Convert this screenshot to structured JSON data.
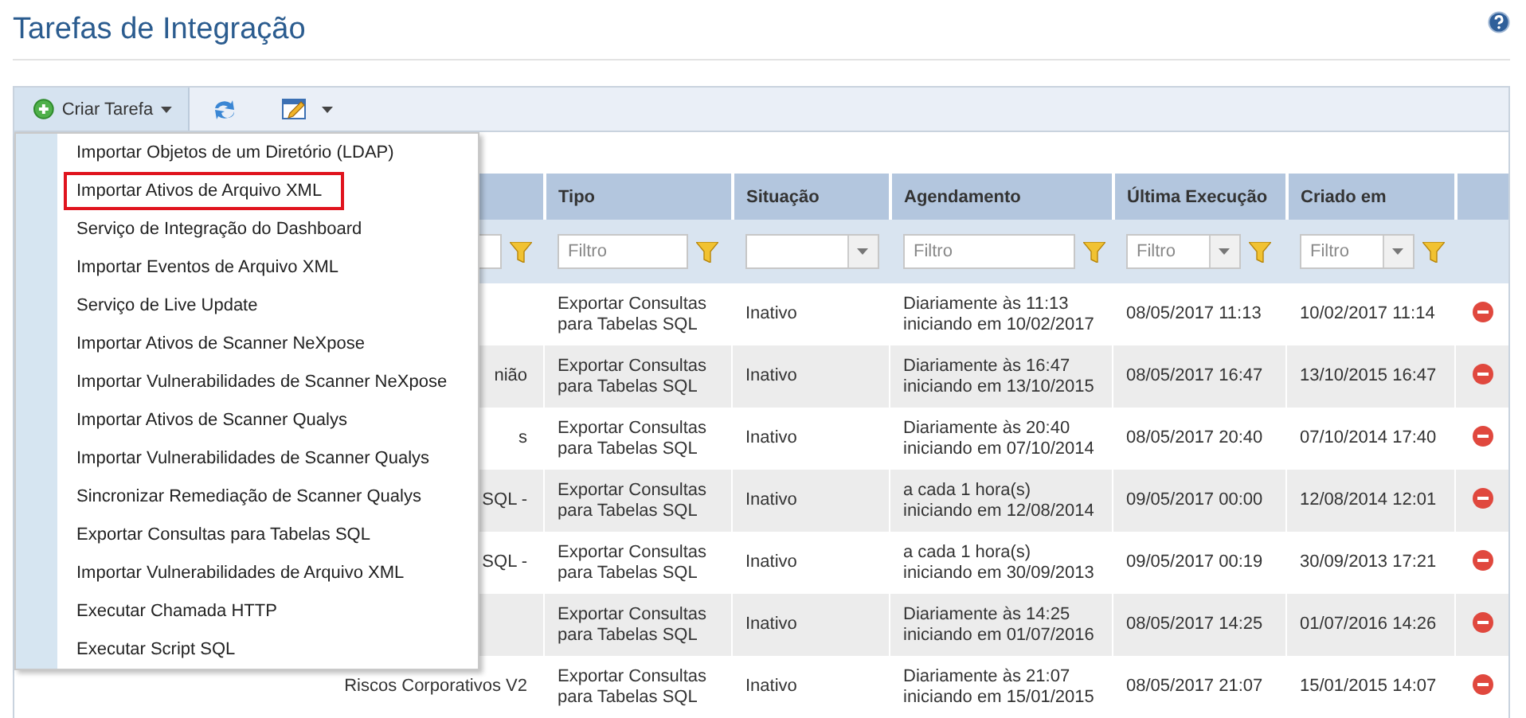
{
  "page": {
    "title": "Tarefas de Integração"
  },
  "toolbar": {
    "create_button": {
      "label": "Criar Tarefa",
      "open": true
    }
  },
  "create_menu": [
    {
      "label": "Importar Objetos de um Diretório (LDAP)",
      "highlighted": false
    },
    {
      "label": "Importar Ativos de Arquivo XML",
      "highlighted": true
    },
    {
      "label": "Serviço de Integração do Dashboard",
      "highlighted": false
    },
    {
      "label": "Importar Eventos de Arquivo XML",
      "highlighted": false
    },
    {
      "label": "Serviço de Live Update",
      "highlighted": false
    },
    {
      "label": "Importar Ativos de Scanner NeXpose",
      "highlighted": false
    },
    {
      "label": "Importar Vulnerabilidades de Scanner NeXpose",
      "highlighted": false
    },
    {
      "label": "Importar Ativos de Scanner Qualys",
      "highlighted": false
    },
    {
      "label": "Importar Vulnerabilidades de Scanner Qualys",
      "highlighted": false
    },
    {
      "label": "Sincronizar Remediação de Scanner Qualys",
      "highlighted": false
    },
    {
      "label": "Exportar Consultas para Tabelas SQL",
      "highlighted": false
    },
    {
      "label": "Importar Vulnerabilidades de Arquivo XML",
      "highlighted": false
    },
    {
      "label": "Executar Chamada HTTP",
      "highlighted": false
    },
    {
      "label": "Executar Script SQL",
      "highlighted": false
    }
  ],
  "table": {
    "columns": [
      "Tipo",
      "Situação",
      "Agendamento",
      "Última Execução",
      "Criado em"
    ],
    "filters": [
      {
        "kind": "text",
        "funnel": true
      },
      {
        "kind": "text",
        "placeholder": "Filtro",
        "funnel": true
      },
      {
        "kind": "select",
        "funnel": false
      },
      {
        "kind": "text",
        "placeholder": "Filtro",
        "funnel": true
      },
      {
        "kind": "select",
        "placeholder": "Filtro",
        "funnel": true
      },
      {
        "kind": "select",
        "placeholder": "Filtro",
        "funnel": true
      }
    ],
    "rows": [
      {
        "type": [
          "Exportar Consultas",
          "para Tabelas SQL"
        ],
        "status": "Inativo",
        "schedule": [
          "Diariamente às 11:13",
          "iniciando em 10/02/2017"
        ],
        "last_run": "08/05/2017 11:13",
        "created": "10/02/2017 11:14"
      },
      {
        "name": "nião",
        "type": [
          "Exportar Consultas",
          "para Tabelas SQL"
        ],
        "status": "Inativo",
        "schedule": [
          "Diariamente às 16:47",
          "iniciando em 13/10/2015"
        ],
        "last_run": "08/05/2017 16:47",
        "created": "13/10/2015 16:47"
      },
      {
        "name": "s",
        "type": [
          "Exportar Consultas",
          "para Tabelas SQL"
        ],
        "status": "Inativo",
        "schedule": [
          "Diariamente às 20:40",
          "iniciando em 07/10/2014"
        ],
        "last_run": "08/05/2017 20:40",
        "created": "07/10/2014 17:40"
      },
      {
        "name": "SQL -",
        "type": [
          "Exportar Consultas",
          "para Tabelas SQL"
        ],
        "status": "Inativo",
        "schedule": [
          "a cada 1 hora(s)",
          "iniciando em 12/08/2014"
        ],
        "last_run": "09/05/2017 00:00",
        "created": "12/08/2014 12:01"
      },
      {
        "name": "SQL -",
        "type": [
          "Exportar Consultas",
          "para Tabelas SQL"
        ],
        "status": "Inativo",
        "schedule": [
          "a cada 1 hora(s)",
          "iniciando em 30/09/2013"
        ],
        "last_run": "09/05/2017 00:19",
        "created": "30/09/2013 17:21"
      },
      {
        "type": [
          "Exportar Consultas",
          "para Tabelas SQL"
        ],
        "status": "Inativo",
        "schedule": [
          "Diariamente às 14:25",
          "iniciando em 01/07/2016"
        ],
        "last_run": "08/05/2017 14:25",
        "created": "01/07/2016 14:26"
      },
      {
        "name": "Riscos Corporativos V2",
        "type": [
          "Exportar Consultas",
          "para Tabelas SQL"
        ],
        "status": "Inativo",
        "schedule": [
          "Diariamente às 21:07",
          "iniciando em 15/01/2015"
        ],
        "last_run": "08/05/2017 21:07",
        "created": "15/01/2015 14:07"
      }
    ]
  }
}
